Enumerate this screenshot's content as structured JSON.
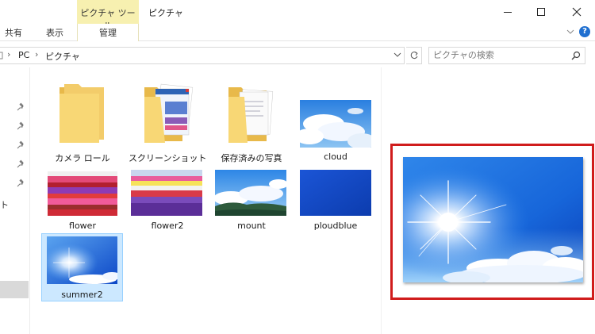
{
  "ribbon": {
    "contextual_group": "ピクチャ ツール",
    "window_title": "ピクチャ",
    "tabs": {
      "share": "共有",
      "view": "表示",
      "manage": "管理"
    },
    "help": "?"
  },
  "window_controls": [
    "minimize-icon",
    "maximize-icon",
    "close-icon"
  ],
  "address": {
    "breadcrumbs": [
      "PC",
      "ピクチャ"
    ]
  },
  "search": {
    "placeholder": "ピクチャの検索"
  },
  "nav_pane": {
    "partial_label": "ト"
  },
  "items": [
    {
      "name": "カメラ ロール",
      "type": "folder"
    },
    {
      "name": "スクリーンショット",
      "type": "folder"
    },
    {
      "name": "保存済みの写真",
      "type": "folder"
    },
    {
      "name": "cloud",
      "type": "image"
    },
    {
      "name": "flower",
      "type": "image"
    },
    {
      "name": "flower2",
      "type": "image"
    },
    {
      "name": "mount",
      "type": "image"
    },
    {
      "name": "ploudblue",
      "type": "image"
    },
    {
      "name": "summer2",
      "type": "image",
      "selected": true
    }
  ],
  "colors": {
    "highlight": "#d01c1c",
    "selection_fill": "#cce8ff",
    "selection_border": "#99d1ff",
    "folder": "#f8d775",
    "sky": "#1a64d8"
  }
}
